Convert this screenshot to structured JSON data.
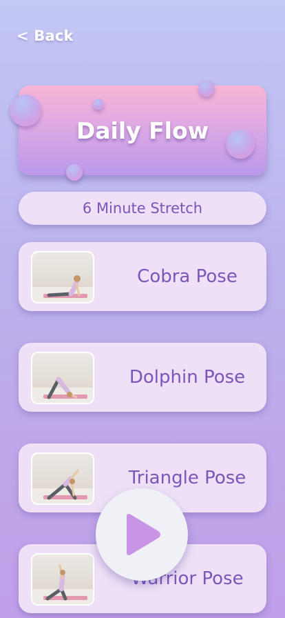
{
  "header": {
    "back_label": "< Back"
  },
  "hero": {
    "title": "Daily Flow"
  },
  "session": {
    "subtitle": "6 Minute Stretch"
  },
  "poses": [
    {
      "label": "Cobra Pose"
    },
    {
      "label": "Dolphin Pose"
    },
    {
      "label": "Triangle Pose"
    },
    {
      "label": "Warrior Pose"
    }
  ],
  "controls": {
    "play_icon": "play-icon"
  },
  "colors": {
    "accent_text": "#7b55b8",
    "card_bg": "#ede0f7",
    "hero_top": "#f8b6d6",
    "hero_bottom": "#bb99ea",
    "play_triangle": "#c993e6"
  }
}
